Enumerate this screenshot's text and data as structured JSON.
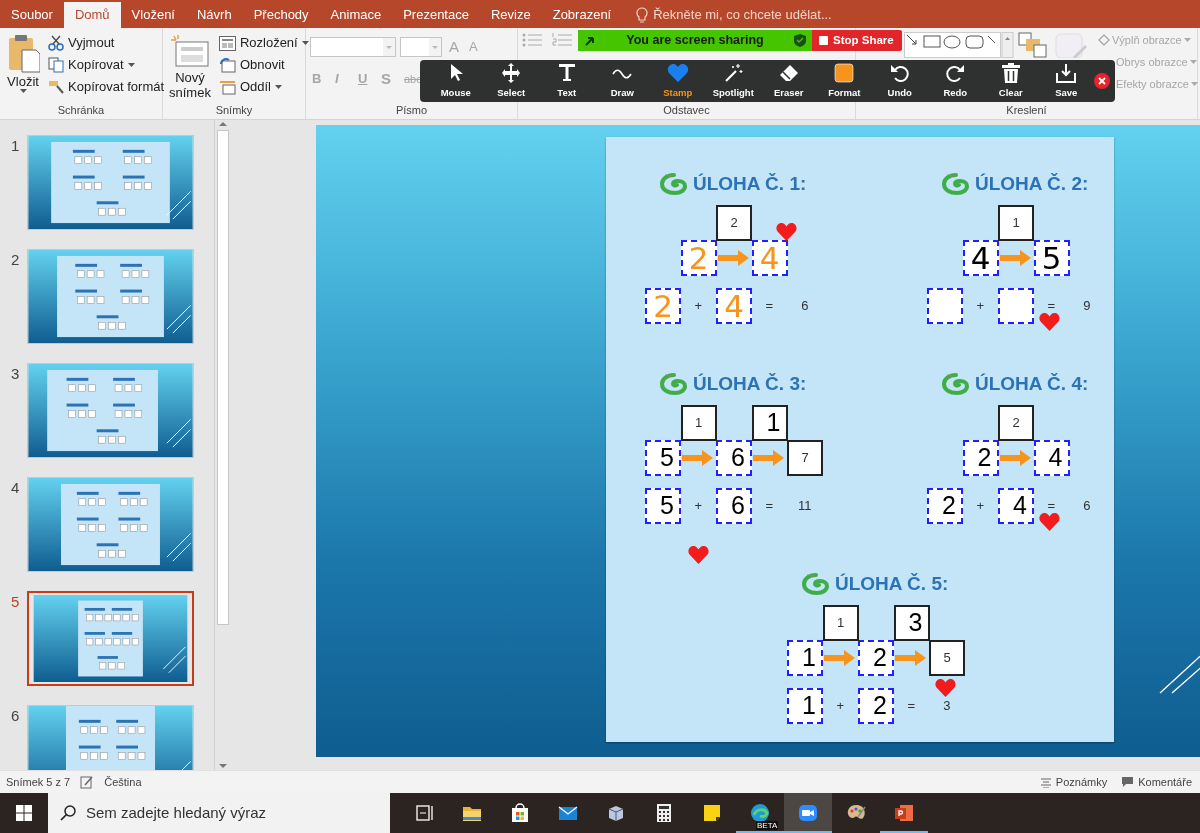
{
  "ribbon_tabs": [
    {
      "label": "Soubor",
      "selected": false
    },
    {
      "label": "Domů",
      "selected": true
    },
    {
      "label": "Vložení",
      "selected": false
    },
    {
      "label": "Návrh",
      "selected": false
    },
    {
      "label": "Přechody",
      "selected": false
    },
    {
      "label": "Animace",
      "selected": false
    },
    {
      "label": "Prezentace",
      "selected": false
    },
    {
      "label": "Revize",
      "selected": false
    },
    {
      "label": "Zobrazení",
      "selected": false
    }
  ],
  "tell_me": "Řekněte mi, co chcete udělat...",
  "clipboard": {
    "label": "Schránka",
    "paste": "Vložit",
    "cut": "Vyjmout",
    "copy": "Kopírovat",
    "format_painter": "Kopírovat formát"
  },
  "slides_group": {
    "label": "Snímky",
    "new_slide": "Nový snímek",
    "layout": "Rozložení",
    "reset": "Obnovit",
    "section": "Oddíl"
  },
  "font_group": {
    "label": "Písmo",
    "disabled": true,
    "size_buttons": [
      "A",
      "A"
    ],
    "format_buttons": [
      "B",
      "I",
      "U",
      "S",
      "abc"
    ]
  },
  "paragraph_group": {
    "label": "Odstavec"
  },
  "drawing_group": {
    "label": "Kreslení",
    "disabled": true,
    "commands": [
      "Výplň obrazce",
      "Obrys obrazce",
      "Efekty obrazce"
    ]
  },
  "share_banner": {
    "text": "You are screen sharing",
    "stop": "Stop Share"
  },
  "annotation_tools": [
    {
      "label": "Mouse",
      "kind": "mouse",
      "selected": false
    },
    {
      "label": "Select",
      "kind": "select",
      "selected": false
    },
    {
      "label": "Text",
      "kind": "text",
      "selected": false
    },
    {
      "label": "Draw",
      "kind": "draw",
      "selected": false
    },
    {
      "label": "Stamp",
      "kind": "stamp",
      "selected": true
    },
    {
      "label": "Spotlight",
      "kind": "spotlight",
      "selected": false
    },
    {
      "label": "Eraser",
      "kind": "eraser",
      "selected": false
    },
    {
      "label": "Format",
      "kind": "format",
      "selected": false
    },
    {
      "label": "Undo",
      "kind": "undo",
      "selected": false
    },
    {
      "label": "Redo",
      "kind": "redo",
      "selected": false
    },
    {
      "label": "Clear",
      "kind": "clear",
      "selected": false
    },
    {
      "label": "Save",
      "kind": "save",
      "selected": false
    }
  ],
  "thumbnails": [
    {
      "number": "1",
      "selected": false
    },
    {
      "number": "2",
      "selected": false
    },
    {
      "number": "3",
      "selected": false
    },
    {
      "number": "4",
      "selected": false
    },
    {
      "number": "5",
      "selected": true
    },
    {
      "number": "6",
      "selected": false
    }
  ],
  "slide": {
    "tasks": [
      {
        "title": "ÚLOHA Č. 1:",
        "top": [
          {
            "kind": "given",
            "text": "2"
          }
        ],
        "chain": [
          {
            "kind": "answer-drawn",
            "text": "2",
            "color": "#f7941d"
          },
          {
            "kind": "answer-drawn",
            "text": "4",
            "color": "#f7941d",
            "stamp": {
              "kind": "heart"
            }
          }
        ],
        "equation": {
          "a": {
            "kind": "answer-drawn",
            "text": "2",
            "color": "#f7941d"
          },
          "plus": "+",
          "b": {
            "kind": "answer-drawn",
            "text": "4",
            "color": "#f7941d"
          },
          "equals": "=",
          "result": "6"
        }
      },
      {
        "title": "ÚLOHA Č. 2:",
        "top": [
          {
            "kind": "given",
            "text": "1"
          }
        ],
        "chain": [
          {
            "kind": "answer-drawn",
            "text": "4",
            "color": "#000000"
          },
          {
            "kind": "answer-drawn",
            "text": "5",
            "color": "#000000"
          }
        ],
        "equation": {
          "a": {
            "kind": "answer"
          },
          "plus": "+",
          "b": {
            "kind": "answer"
          },
          "equals": "=",
          "equals_stamp": {
            "kind": "heart"
          },
          "result": "9"
        }
      },
      {
        "title": "ÚLOHA Č. 3:",
        "top": [
          {
            "kind": "given",
            "text": "1"
          },
          {
            "kind": "given-typed",
            "text": "1"
          }
        ],
        "chain": [
          {
            "kind": "answer-typed",
            "text": "5"
          },
          {
            "kind": "answer-typed",
            "text": "6"
          },
          {
            "kind": "given",
            "text": "7"
          }
        ],
        "equation": {
          "a": {
            "kind": "answer-typed",
            "text": "5"
          },
          "plus": "+",
          "plus_stamp": {
            "kind": "heart"
          },
          "b": {
            "kind": "answer-typed",
            "text": "6"
          },
          "equals": "=",
          "result": "11"
        }
      },
      {
        "title": "ÚLOHA Č. 4:",
        "top": [
          {
            "kind": "given",
            "text": "2"
          }
        ],
        "chain": [
          {
            "kind": "answer-typed",
            "text": "2"
          },
          {
            "kind": "answer-typed",
            "text": "4"
          }
        ],
        "equation": {
          "a": {
            "kind": "answer-typed",
            "text": "2"
          },
          "plus": "+",
          "b": {
            "kind": "answer-typed",
            "text": "4"
          },
          "equals": "=",
          "equals_stamp": {
            "kind": "heart"
          },
          "result": "6"
        }
      },
      {
        "title": "ÚLOHA Č. 5:",
        "top": [
          {
            "kind": "given",
            "text": "1"
          },
          {
            "kind": "given-typed",
            "text": "3"
          }
        ],
        "chain": [
          {
            "kind": "answer-typed",
            "text": "1"
          },
          {
            "kind": "answer-typed",
            "text": "2"
          },
          {
            "kind": "given",
            "text": "5"
          }
        ],
        "equation": {
          "a": {
            "kind": "answer-typed",
            "text": "1"
          },
          "plus": "+",
          "b": {
            "kind": "answer-typed",
            "text": "2"
          },
          "equals": "=",
          "result": "3",
          "result_stamp": {
            "kind": "heart"
          }
        }
      }
    ]
  },
  "status_bar": {
    "slide_counter": "Snímek 5 z 7",
    "language": "Čeština",
    "notes": "Poznámky",
    "comments": "Komentáře"
  },
  "taskbar": {
    "search_placeholder": "Sem zadejte hledaný výraz",
    "apps": [
      {
        "kind": "task-view",
        "running": false,
        "active": false
      },
      {
        "kind": "folder",
        "running": false,
        "active": false
      },
      {
        "kind": "store",
        "running": false,
        "active": false
      },
      {
        "kind": "mail",
        "running": false,
        "active": false
      },
      {
        "kind": "app",
        "running": false,
        "active": false
      },
      {
        "kind": "calculator",
        "running": false,
        "active": false
      },
      {
        "kind": "sticky",
        "running": false,
        "active": false
      },
      {
        "kind": "browser",
        "running": true,
        "active": false,
        "badge": "BETA"
      },
      {
        "kind": "video",
        "running": true,
        "active": true
      },
      {
        "kind": "paint",
        "running": false,
        "active": false
      },
      {
        "kind": "slides",
        "running": true,
        "active": false
      }
    ]
  }
}
